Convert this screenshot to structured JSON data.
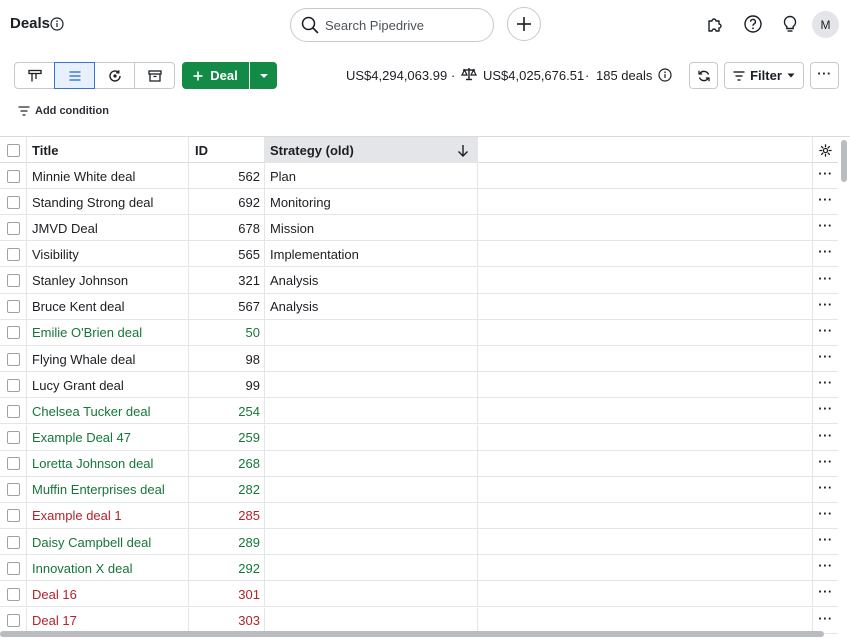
{
  "header": {
    "title": "Deals",
    "search_placeholder": "Search Pipedrive",
    "avatar_initial": "M"
  },
  "toolbar": {
    "views": [
      "pipeline-icon",
      "list-icon",
      "forecast-icon",
      "archive-icon"
    ],
    "active_view": "list-icon",
    "add_deal_label": "Deal",
    "total_value": "US$4,294,063.99",
    "weighted_value": "US$4,025,676.51",
    "deal_count": "185 deals",
    "filter_label": "Filter",
    "add_condition_label": "Add condition"
  },
  "table": {
    "columns": [
      "Title",
      "ID",
      "Strategy (old)"
    ],
    "rows": [
      {
        "title": "Minnie White deal",
        "id": "562",
        "strategy": "Plan",
        "status": "open"
      },
      {
        "title": "Standing Strong deal",
        "id": "692",
        "strategy": "Monitoring",
        "status": "open"
      },
      {
        "title": "JMVD Deal",
        "id": "678",
        "strategy": "Mission",
        "status": "open"
      },
      {
        "title": "Visibility",
        "id": "565",
        "strategy": "Implementation",
        "status": "open"
      },
      {
        "title": "Stanley Johnson",
        "id": "321",
        "strategy": "Analysis",
        "status": "open"
      },
      {
        "title": "Bruce Kent deal",
        "id": "567",
        "strategy": "Analysis",
        "status": "open"
      },
      {
        "title": "Emilie O'Brien deal",
        "id": "50",
        "strategy": "",
        "status": "won"
      },
      {
        "title": "Flying Whale deal",
        "id": "98",
        "strategy": "",
        "status": "open"
      },
      {
        "title": "Lucy Grant deal",
        "id": "99",
        "strategy": "",
        "status": "open"
      },
      {
        "title": "Chelsea Tucker deal",
        "id": "254",
        "strategy": "",
        "status": "won"
      },
      {
        "title": "Example Deal 47",
        "id": "259",
        "strategy": "",
        "status": "won"
      },
      {
        "title": "Loretta Johnson deal",
        "id": "268",
        "strategy": "",
        "status": "won"
      },
      {
        "title": "Muffin Enterprises deal",
        "id": "282",
        "strategy": "",
        "status": "won"
      },
      {
        "title": "Example deal 1",
        "id": "285",
        "strategy": "",
        "status": "lost"
      },
      {
        "title": "Daisy Campbell deal",
        "id": "289",
        "strategy": "",
        "status": "won"
      },
      {
        "title": "Innovation X deal",
        "id": "292",
        "strategy": "",
        "status": "won"
      },
      {
        "title": "Deal 16",
        "id": "301",
        "strategy": "",
        "status": "lost"
      },
      {
        "title": "Deal 17",
        "id": "303",
        "strategy": "",
        "status": "lost"
      }
    ]
  },
  "colors": {
    "brand_green": "#138a45",
    "won_text": "#16763a",
    "lost_text": "#b3232b",
    "active_view": "#3773d6"
  }
}
